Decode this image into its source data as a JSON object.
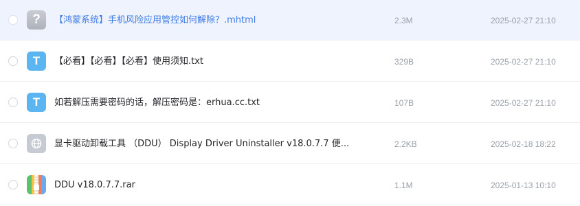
{
  "files": [
    {
      "name": "【鸿蒙系统】手机风险应用管控如何解除？.mhtml",
      "size": "2.3M",
      "date": "2025-02-27 21:10",
      "icon": "unknown-file-icon",
      "icon_glyph": "?",
      "selected": true
    },
    {
      "name": "【必看】【必看】【必看】使用须知.txt",
      "size": "329B",
      "date": "2025-02-27 21:10",
      "icon": "text-file-icon",
      "icon_glyph": "T",
      "selected": false
    },
    {
      "name": "如若解压需要密码的话，解压密码是：erhua.cc.txt",
      "size": "107B",
      "date": "2025-02-27 21:10",
      "icon": "text-file-icon",
      "icon_glyph": "T",
      "selected": false
    },
    {
      "name": "显卡驱动卸载工具 （DDU） Display Driver Uninstaller v18.0.7.7 便...",
      "size": "2.2KB",
      "date": "2025-02-18 18:22",
      "icon": "web-link-icon",
      "icon_glyph": "",
      "selected": false
    },
    {
      "name": "DDU v18.0.7.7.rar",
      "size": "1.1M",
      "date": "2025-01-13 10:10",
      "icon": "archive-file-icon",
      "icon_glyph": "",
      "selected": false
    }
  ],
  "colors": {
    "selected_row_bg": "#eef3fd",
    "selected_text": "#3d7be5",
    "meta_text": "#9aa0aa",
    "txt_icon": "#5bb5f1"
  }
}
